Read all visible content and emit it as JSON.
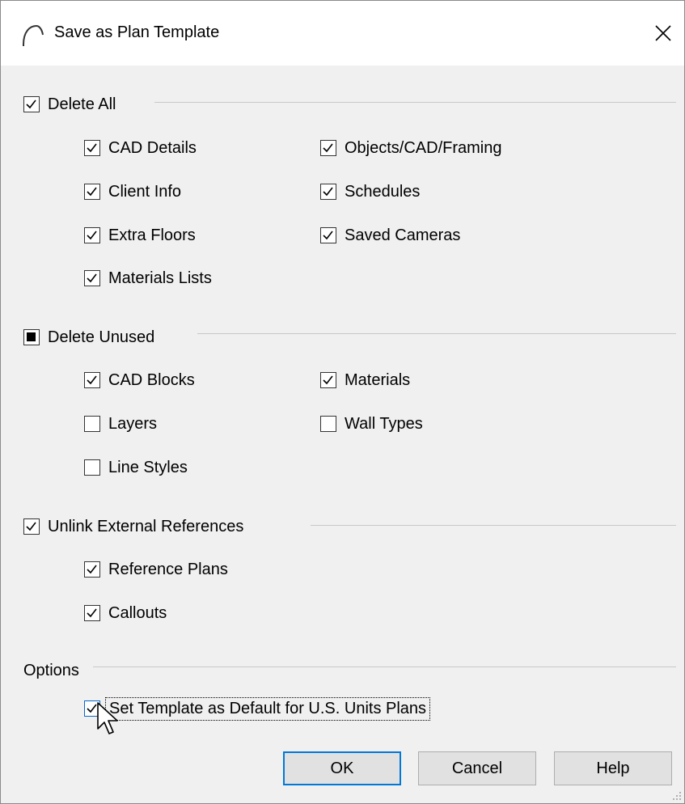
{
  "dialog": {
    "title": "Save as Plan Template",
    "app_icon": "arc-icon",
    "close_icon": "close-icon"
  },
  "groups": {
    "delete_all": {
      "label": "Delete All",
      "state": "checked",
      "items": [
        {
          "label": "CAD Details",
          "checked": true
        },
        {
          "label": "Objects/CAD/Framing",
          "checked": true
        },
        {
          "label": "Client Info",
          "checked": true
        },
        {
          "label": "Schedules",
          "checked": true
        },
        {
          "label": "Extra Floors",
          "checked": true
        },
        {
          "label": "Saved Cameras",
          "checked": true
        },
        {
          "label": "Materials Lists",
          "checked": true
        }
      ]
    },
    "delete_unused": {
      "label": "Delete Unused",
      "state": "indeterminate",
      "items": [
        {
          "label": "CAD Blocks",
          "checked": true
        },
        {
          "label": "Materials",
          "checked": true
        },
        {
          "label": "Layers",
          "checked": false
        },
        {
          "label": "Wall Types",
          "checked": false
        },
        {
          "label": "Line Styles",
          "checked": false
        }
      ]
    },
    "unlink": {
      "label": "Unlink External References",
      "state": "checked",
      "items": [
        {
          "label": "Reference Plans",
          "checked": true
        },
        {
          "label": "Callouts",
          "checked": true
        }
      ]
    }
  },
  "options": {
    "label": "Options",
    "default_template": {
      "label": "Set Template as Default for U.S. Units Plans",
      "checked": true
    }
  },
  "buttons": {
    "ok": "OK",
    "cancel": "Cancel",
    "help": "Help"
  },
  "colors": {
    "accent": "#0078d7",
    "background": "#f0f0f0"
  }
}
